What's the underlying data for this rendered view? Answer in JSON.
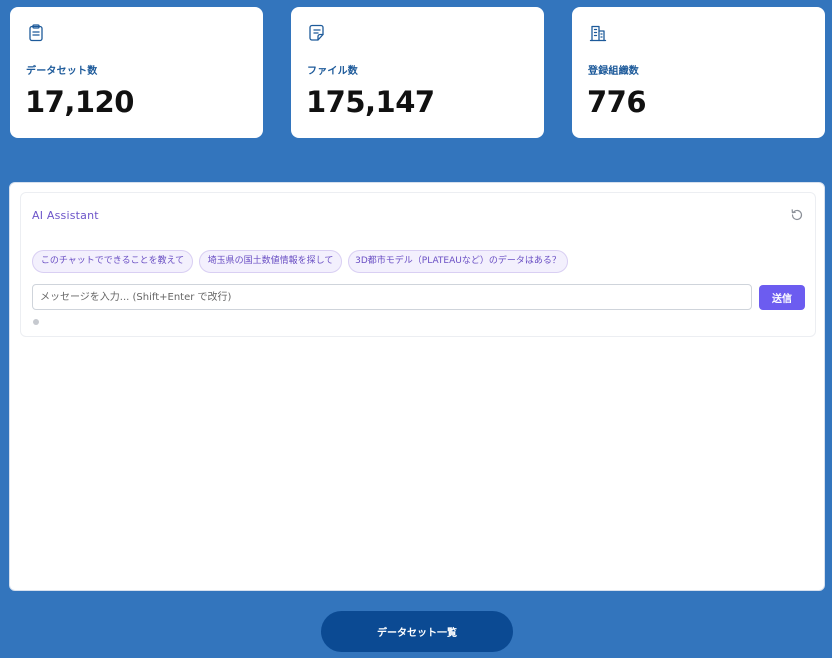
{
  "stats": [
    {
      "label": "データセット数",
      "value": "17,120",
      "icon": "clipboard-icon"
    },
    {
      "label": "ファイル数",
      "value": "175,147",
      "icon": "document-icon"
    },
    {
      "label": "登録組織数",
      "value": "776",
      "icon": "building-icon"
    }
  ],
  "assistant": {
    "title": "AI Assistant",
    "reset_icon": "refresh-icon",
    "suggestions": [
      "このチャットでできることを教えて",
      "埼玉県の国土数値情報を探して",
      "3D都市モデル（PLATEAUなど）のデータはある？"
    ],
    "input": {
      "value": "",
      "placeholder": "メッセージを入力... (Shift+Enter で改行)"
    },
    "send_label": "送信"
  },
  "footer": {
    "dataset_list_label": "データセット一覧"
  },
  "colors": {
    "background": "#3375bd",
    "stat_label": "#1d5a9a",
    "accent_purple": "#6c5cf0",
    "primary_button": "#0b4a93"
  }
}
